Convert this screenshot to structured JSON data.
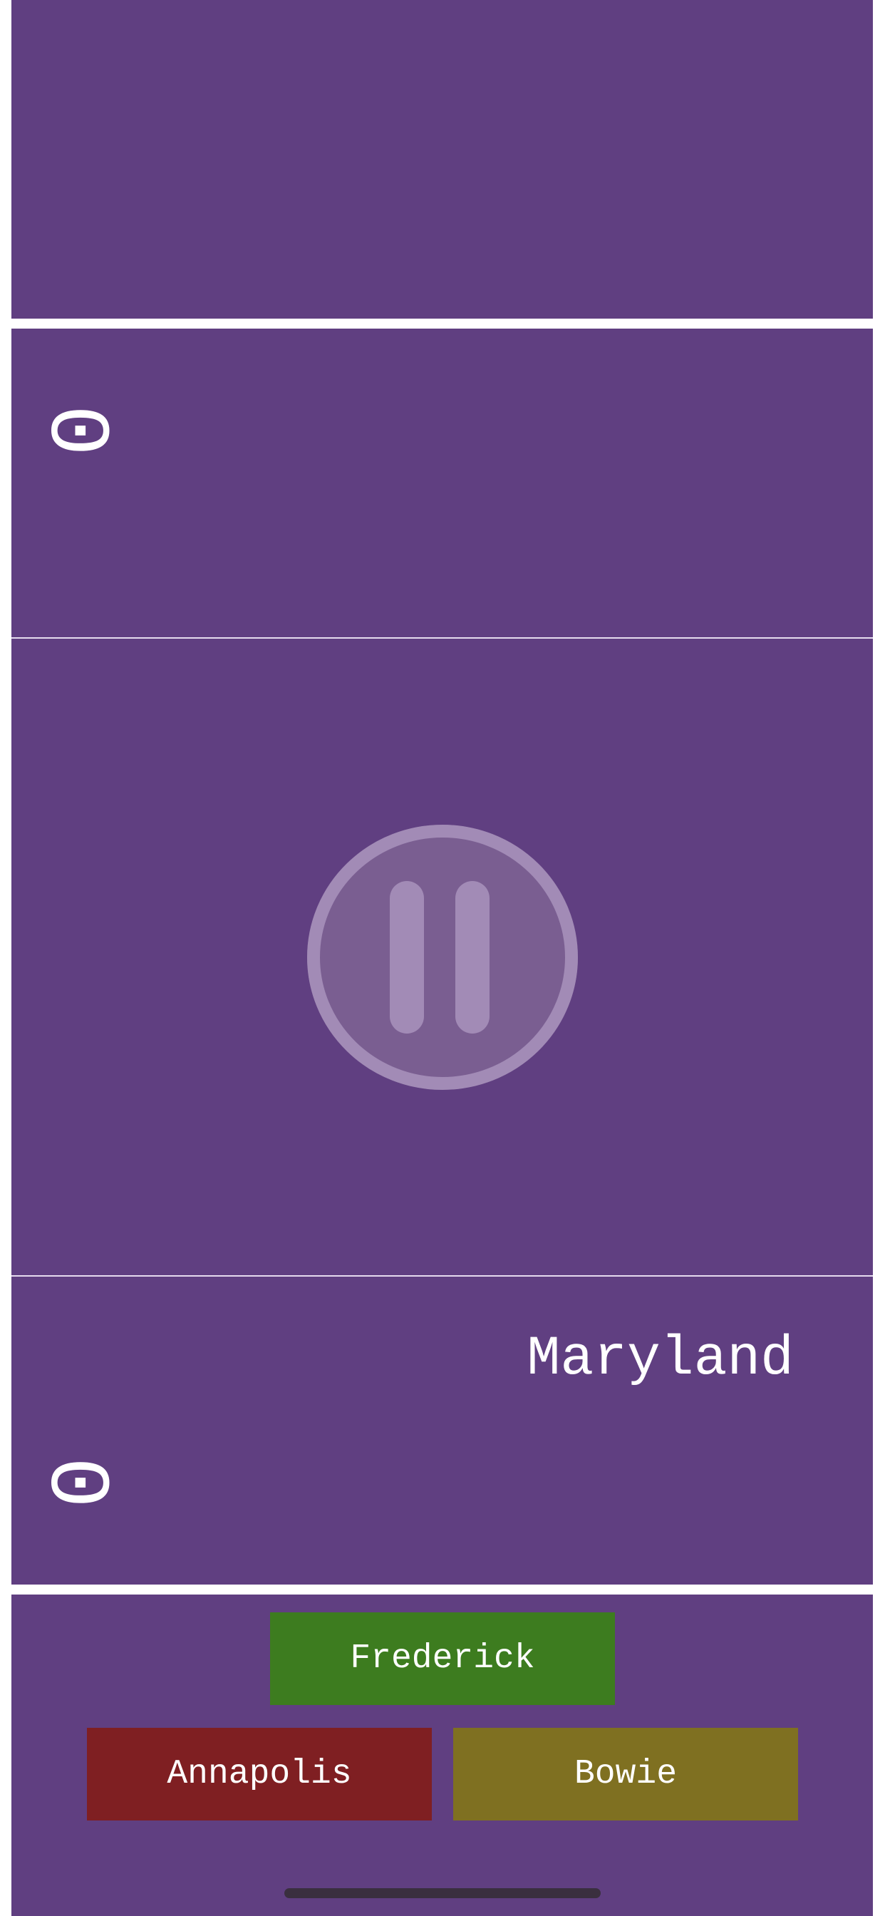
{
  "game": {
    "opponent_score": "0",
    "player_score": "0",
    "question": "Maryland",
    "answers": [
      {
        "label": "Frederick",
        "color": "#3d7c1f"
      },
      {
        "label": "Annapolis",
        "color": "#7f1f22"
      },
      {
        "label": "Bowie",
        "color": "#7f7021"
      }
    ]
  },
  "controls": {
    "pause_icon": "pause-circle-icon"
  },
  "colors": {
    "background": "#603f81",
    "divider": "#ffffff"
  }
}
